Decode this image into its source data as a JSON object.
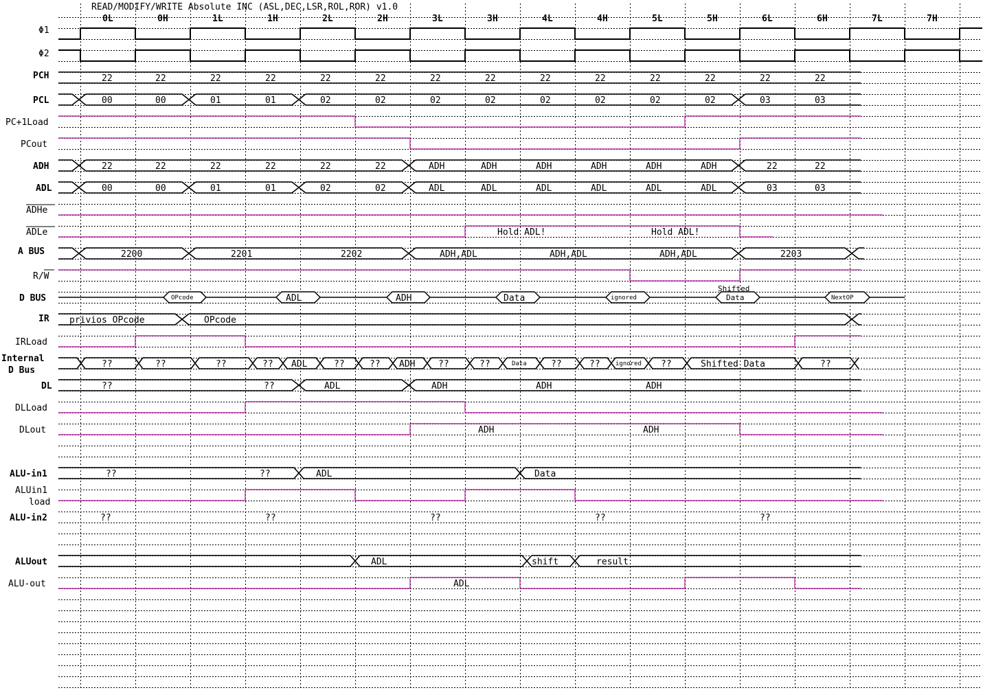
{
  "title": "READ/MODIFY/WRITE Absolute INC (ASL,DEC,LSR,ROL,ROR) v1.0",
  "colors": {
    "control_line": "#b5179e",
    "bus_line": "#000000"
  },
  "phases": [
    "0L",
    "0H",
    "1L",
    "1H",
    "2L",
    "2H",
    "3L",
    "3H",
    "4L",
    "4H",
    "5L",
    "5H",
    "6L",
    "6H",
    "7L",
    "7H"
  ],
  "signals": {
    "phi1": "Φ1",
    "phi2": "Φ2",
    "pch": "PCH",
    "pcl": "PCL",
    "pc1load": "PC+1Load",
    "pcout": "PCout",
    "adh": "ADH",
    "adl": "ADL",
    "adhe": "ADHe",
    "adle": "ADLe",
    "abus": "A BUS",
    "rw": "R/W",
    "dbus": "D BUS",
    "ir": "IR",
    "irload": "IRLoad",
    "internal_1": "Internal",
    "internal_2": "D Bus",
    "dl": "DL",
    "dlload": "DLLoad",
    "dlout": "DLout",
    "aluin1": "ALU-in1",
    "aluin1load_1": "ALUin1",
    "aluin1load_2": "load",
    "aluin2": "ALU-in2",
    "aluout": "ALUout",
    "aluoutctl": "ALU-out"
  },
  "values": {
    "pch": [
      "22",
      "22",
      "22",
      "22",
      "22",
      "22",
      "22",
      "22",
      "22",
      "22",
      "22",
      "22",
      "22",
      "22"
    ],
    "pcl": [
      "00",
      "00",
      "01",
      "01",
      "02",
      "02",
      "02",
      "02",
      "02",
      "02",
      "02",
      "02",
      "03",
      "03"
    ],
    "adh": [
      "22",
      "22",
      "22",
      "22",
      "22",
      "22",
      "ADH",
      "ADH",
      "ADH",
      "ADH",
      "ADH",
      "ADH",
      "22",
      "22"
    ],
    "adl": [
      "00",
      "00",
      "01",
      "01",
      "02",
      "02",
      "ADL",
      "ADL",
      "ADL",
      "ADL",
      "ADL",
      "ADL",
      "03",
      "03"
    ],
    "adle_note1": "Hold ADL!",
    "adle_note2": "Hold ADL!",
    "abus": [
      "2200",
      "2201",
      "2202",
      "ADH,ADL",
      "ADH,ADL",
      "ADH,ADL",
      "2203"
    ],
    "dbus": [
      "OPcode",
      "ADL",
      "ADH",
      "Data",
      "ignored",
      "Shifted",
      "Data",
      "NextOP"
    ],
    "ir": [
      "privios OPcode",
      "OPcode"
    ],
    "internal": [
      "??",
      "??",
      "??",
      "??",
      "ADL",
      "??",
      "??",
      "ADH",
      "??",
      "??",
      "Data",
      "??",
      "??",
      "ignored",
      "??",
      "Shifted Data",
      "??"
    ],
    "dl": [
      "??",
      "??",
      "ADL",
      "ADH",
      "ADH",
      "ADH"
    ],
    "dlout": [
      "ADH",
      "ADH"
    ],
    "aluin1": [
      "??",
      "??",
      "ADL",
      "Data"
    ],
    "aluin2": [
      "??",
      "??",
      "??",
      "??",
      "??"
    ],
    "aluout": [
      "ADL",
      "shift",
      "result"
    ],
    "aluoutctl": [
      "ADL"
    ]
  }
}
